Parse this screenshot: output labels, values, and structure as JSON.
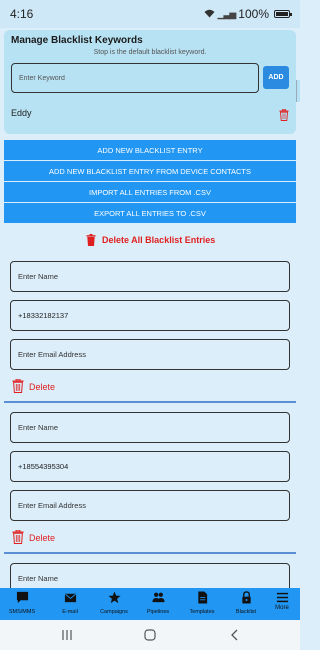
{
  "status": {
    "time": "4:16",
    "battery": "100%"
  },
  "keywords": {
    "title": "Manage Blacklist Keywords",
    "subtitle": "Stop is the default blacklist keyword.",
    "input_placeholder": "Enter Keyword",
    "add_label": "ADD",
    "entries": [
      "Eddy"
    ]
  },
  "actions": [
    "ADD NEW BLACKLIST ENTRY",
    "ADD NEW BLACKLIST ENTRY FROM DEVICE CONTACTS",
    "IMPORT ALL ENTRIES FROM .CSV",
    "EXPORT ALL ENTRIES TO .CSV"
  ],
  "delete_all_label": "Delete All Blacklist Entries",
  "entries": [
    {
      "name_placeholder": "Enter Name",
      "phone": "+18332182137",
      "email_placeholder": "Enter Email Address",
      "delete_label": "Delete"
    },
    {
      "name_placeholder": "Enter Name",
      "phone": "+18554395304",
      "email_placeholder": "Enter Email Address",
      "delete_label": "Delete"
    },
    {
      "name_placeholder": "Enter Name"
    }
  ],
  "nav": {
    "items": [
      "SMS/MMS",
      "E-mail",
      "Campaigns",
      "Pipelines",
      "Templates",
      "Blacklist",
      "More"
    ]
  },
  "colors": {
    "accent": "#2196f3",
    "danger": "#e02020",
    "background": "#dbeefa",
    "card": "#b7e2f3"
  }
}
